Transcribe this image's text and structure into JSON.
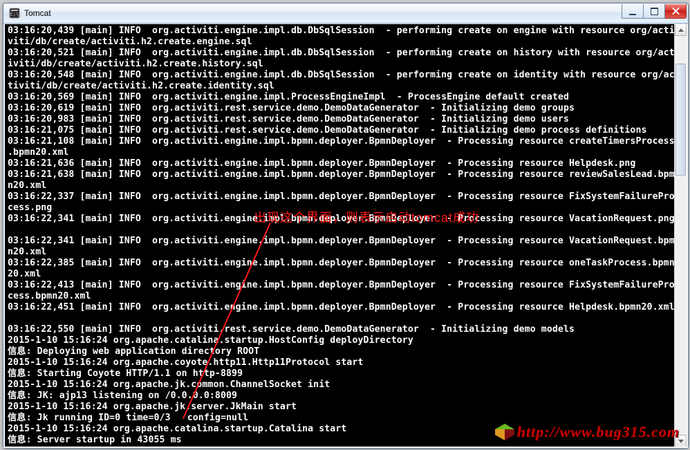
{
  "window": {
    "title": "Tomcat"
  },
  "console_lines": [
    "03:16:20,439 [main] INFO  org.activiti.engine.impl.db.DbSqlSession  - performing create on engine with resource org/acti",
    "viti/db/create/activiti.h2.create.engine.sql",
    "03:16:20,521 [main] INFO  org.activiti.engine.impl.db.DbSqlSession  - performing create on history with resource org/act",
    "iviti/db/create/activiti.h2.create.history.sql",
    "03:16:20,548 [main] INFO  org.activiti.engine.impl.db.DbSqlSession  - performing create on identity with resource org/ac",
    "tiviti/db/create/activiti.h2.create.identity.sql",
    "03:16:20,569 [main] INFO  org.activiti.engine.impl.ProcessEngineImpl  - ProcessEngine default created",
    "03:16:20,619 [main] INFO  org.activiti.rest.service.demo.DemoDataGenerator  - Initializing demo groups",
    "03:16:20,983 [main] INFO  org.activiti.rest.service.demo.DemoDataGenerator  - Initializing demo users",
    "03:16:21,075 [main] INFO  org.activiti.rest.service.demo.DemoDataGenerator  - Initializing demo process definitions",
    "03:16:21,108 [main] INFO  org.activiti.engine.impl.bpmn.deployer.BpmnDeployer  - Processing resource createTimersProcess",
    ".bpmn20.xml",
    "03:16:21,636 [main] INFO  org.activiti.engine.impl.bpmn.deployer.BpmnDeployer  - Processing resource Helpdesk.png",
    "03:16:21,638 [main] INFO  org.activiti.engine.impl.bpmn.deployer.BpmnDeployer  - Processing resource reviewSalesLead.bpm",
    "n20.xml",
    "03:16:22,337 [main] INFO  org.activiti.engine.impl.bpmn.deployer.BpmnDeployer  - Processing resource FixSystemFailurePro",
    "cess.png",
    "03:16:22,341 [main] INFO  org.activiti.engine.impl.bpmn.deployer.BpmnDeployer  - Processing resource VacationRequest.png",
    "",
    "03:16:22,341 [main] INFO  org.activiti.engine.impl.bpmn.deployer.BpmnDeployer  - Processing resource VacationRequest.bpm",
    "n20.xml",
    "03:16:22,385 [main] INFO  org.activiti.engine.impl.bpmn.deployer.BpmnDeployer  - Processing resource oneTaskProcess.bpmn",
    "20.xml",
    "03:16:22,413 [main] INFO  org.activiti.engine.impl.bpmn.deployer.BpmnDeployer  - Processing resource FixSystemFailurePro",
    "cess.bpmn20.xml",
    "03:16:22,451 [main] INFO  org.activiti.engine.impl.bpmn.deployer.BpmnDeployer  - Processing resource Helpdesk.bpmn20.xml",
    "",
    "03:16:22,550 [main] INFO  org.activiti.rest.service.demo.DemoDataGenerator  - Initializing demo models",
    "2015-1-10 15:16:24 org.apache.catalina.startup.HostConfig deployDirectory",
    "信息: Deploying web application directory ROOT",
    "2015-1-10 15:16:24 org.apache.coyote.http11.Http11Protocol start",
    "信息: Starting Coyote HTTP/1.1 on http-8899",
    "2015-1-10 15:16:24 org.apache.jk.common.ChannelSocket init",
    "信息: JK: ajp13 listening on /0.0.0.0:8009",
    "2015-1-10 15:16:24 org.apache.jk.server.JkMain start",
    "信息: Jk running ID=0 time=0/3   config=null",
    "2015-1-10 15:16:24 org.apache.catalina.startup.Catalina start",
    "信息: Server startup in 43055 ms"
  ],
  "annotation": {
    "text": "出现这个界面，则表示启动tomcat成功"
  },
  "watermark": {
    "url": "http://www.bug315.com"
  }
}
